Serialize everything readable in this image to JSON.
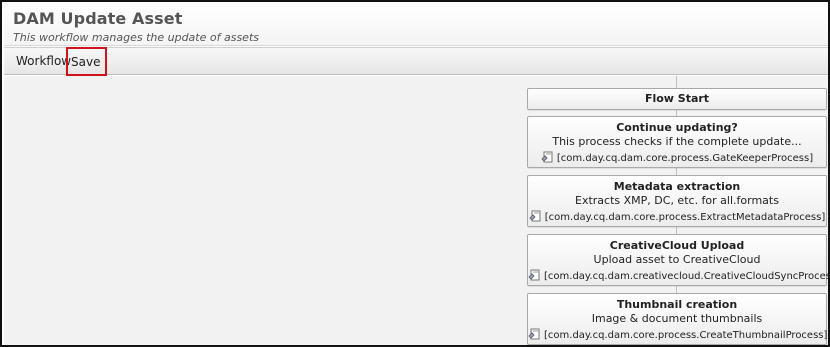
{
  "header": {
    "title": "DAM Update Asset",
    "subtitle": "This workflow manages the update of assets"
  },
  "toolbar": {
    "workflow_label": "Workflow",
    "save_label": "Save"
  },
  "flow": {
    "start_label": "Flow Start",
    "steps": [
      {
        "title": "Continue updating?",
        "description": "This process checks if the complete update...",
        "process": "[com.day.cq.dam.core.process.GateKeeperProcess]"
      },
      {
        "title": "Metadata extraction",
        "description": "Extracts XMP, DC, etc. for all.formats",
        "process": "[com.day.cq.dam.core.process.ExtractMetadataProcess]"
      },
      {
        "title": "CreativeCloud Upload",
        "description": "Upload asset to CreativeCloud",
        "process": "[com.day.cq.dam.creativecloud.CreativeCloudSyncProcess]"
      },
      {
        "title": "Thumbnail creation",
        "description": "Image & document thumbnails",
        "process": "[com.day.cq.dam.core.process.CreateThumbnailProcess]"
      }
    ]
  },
  "icons": {
    "process": "process-script-icon"
  },
  "colors": {
    "highlight": "#d0141b",
    "title_text": "#555555"
  }
}
